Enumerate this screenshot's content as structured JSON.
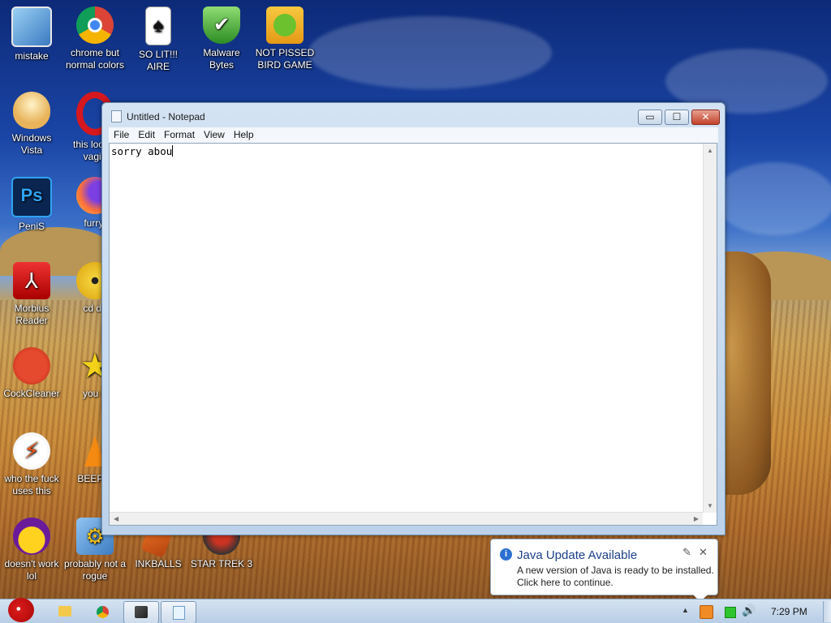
{
  "desktop": {
    "icons": [
      {
        "label": "mistake"
      },
      {
        "label": "chrome but normal colors"
      },
      {
        "label": "SO LIT!!! AIRE"
      },
      {
        "label": "Malware Bytes"
      },
      {
        "label": "NOT PISSED BIRD GAME"
      },
      {
        "label": "Windows Vista"
      },
      {
        "label": "this look a vagin"
      },
      {
        "label": "PeniS"
      },
      {
        "label": "furryf"
      },
      {
        "label": "Morbius Reader"
      },
      {
        "label": "cd dri"
      },
      {
        "label": "CockCleaner"
      },
      {
        "label": "you tr"
      },
      {
        "label": "who the fuck uses this"
      },
      {
        "label": "BEEP B"
      },
      {
        "label": "doesn't work lol"
      },
      {
        "label": "probably not a rogue"
      },
      {
        "label": "INKBALLS"
      },
      {
        "label": "STAR TREK 3"
      }
    ]
  },
  "notepad": {
    "title": "Untitled - Notepad",
    "menu": [
      "File",
      "Edit",
      "Format",
      "View",
      "Help"
    ],
    "content": "sorry abou",
    "buttons": {
      "minimize": "▭",
      "maximize": "☐",
      "close": "✕"
    }
  },
  "notification": {
    "title": "Java Update Available",
    "line1": "A new version of Java is ready to be installed.",
    "line2": "Click here to continue.",
    "info_glyph": "i",
    "pin_glyph": "✎",
    "close_glyph": "✕"
  },
  "taskbar": {
    "clock": "7:29 PM",
    "show_hidden_glyph": "▲"
  },
  "colors": {
    "accent": "#1d3f8a",
    "taskbar": "#c3d5e9"
  }
}
